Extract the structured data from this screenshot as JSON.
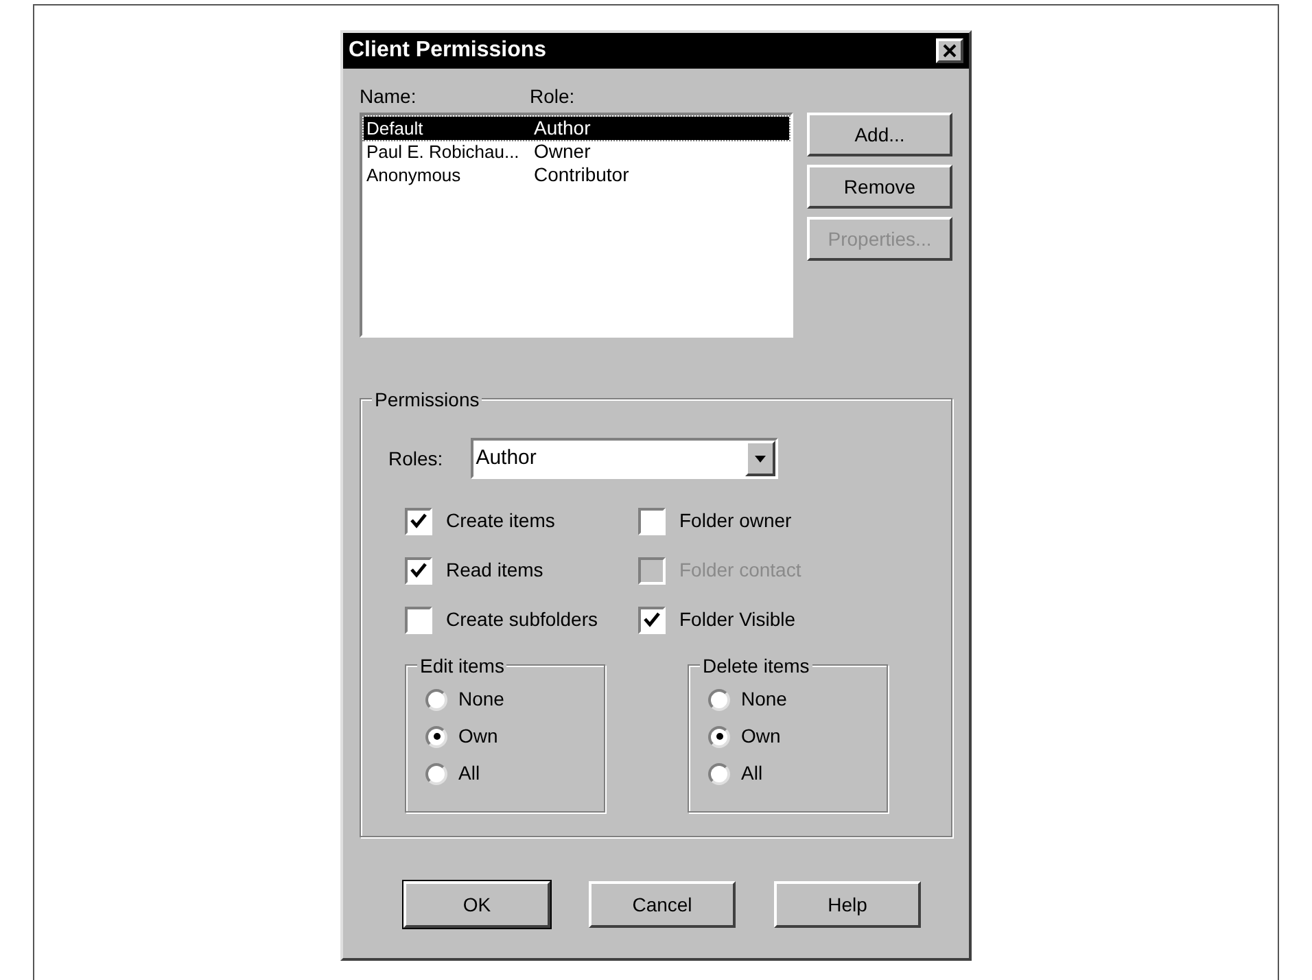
{
  "window": {
    "title": "Client Permissions"
  },
  "list": {
    "columns": [
      "Name:",
      "Role:"
    ],
    "rows": [
      {
        "name": "Default",
        "role": "Author",
        "selected": true
      },
      {
        "name": "Paul E. Robichau...",
        "role": "Owner",
        "selected": false
      },
      {
        "name": "Anonymous",
        "role": "Contributor",
        "selected": false
      }
    ]
  },
  "side_buttons": [
    {
      "label": "Add...",
      "disabled": false
    },
    {
      "label": "Remove",
      "disabled": false
    },
    {
      "label": "Properties...",
      "disabled": true
    }
  ],
  "permissions": {
    "title": "Permissions",
    "roles_label": "Roles:",
    "roles_value": "Author",
    "checkboxes": [
      {
        "label": "Create items",
        "checked": true,
        "disabled": false
      },
      {
        "label": "Folder owner",
        "checked": false,
        "disabled": false
      },
      {
        "label": "Read items",
        "checked": true,
        "disabled": false
      },
      {
        "label": "Folder contact",
        "checked": false,
        "disabled": true
      },
      {
        "label": "Create subfolders",
        "checked": false,
        "disabled": false
      },
      {
        "label": "Folder Visible",
        "checked": true,
        "disabled": false
      }
    ],
    "radio_groups": [
      {
        "title": "Edit items",
        "options": [
          {
            "label": "None",
            "selected": false
          },
          {
            "label": "Own",
            "selected": true
          },
          {
            "label": "All",
            "selected": false
          }
        ]
      },
      {
        "title": "Delete items",
        "options": [
          {
            "label": "None",
            "selected": false
          },
          {
            "label": "Own",
            "selected": true
          },
          {
            "label": "All",
            "selected": false
          }
        ]
      }
    ]
  },
  "buttons": [
    {
      "label": "OK",
      "default": true
    },
    {
      "label": "Cancel",
      "default": false
    },
    {
      "label": "Help",
      "default": false
    }
  ]
}
